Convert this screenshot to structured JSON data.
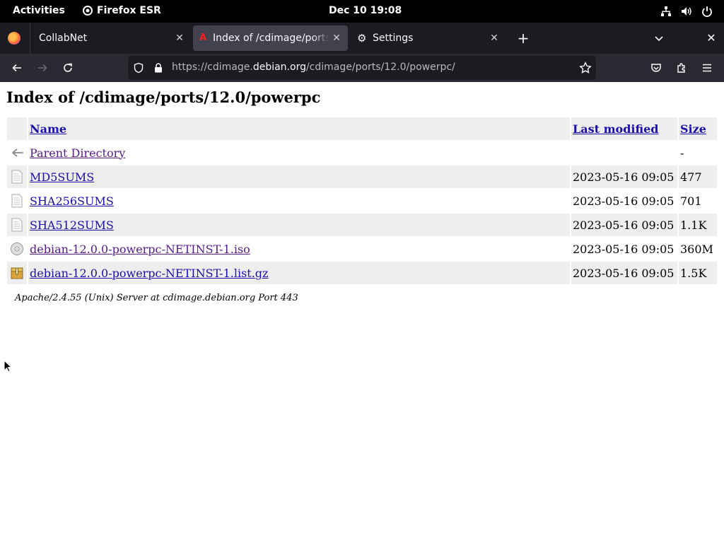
{
  "topbar": {
    "activities": "Activities",
    "app_name": "Firefox ESR",
    "clock": "Dec 10  19:08"
  },
  "tabs": [
    {
      "label": "CollabNet"
    },
    {
      "label": "Index of /cdimage/ports/12.0/powerpc/"
    },
    {
      "label": "Settings"
    }
  ],
  "urlbar": {
    "url_prefix": "https://cdimage.",
    "url_domain": "debian.org",
    "url_suffix": "/cdimage/ports/12.0/powerpc/"
  },
  "page": {
    "title": "Index of /cdimage/ports/12.0/powerpc",
    "columns": {
      "name": "Name",
      "modified": "Last modified",
      "size": "Size"
    },
    "rows": [
      {
        "icon": "back-icon",
        "name": "Parent Directory",
        "modified": "",
        "size": "-"
      },
      {
        "icon": "text-file-icon",
        "name": "MD5SUMS",
        "modified": "2023-05-16 09:05",
        "size": "477"
      },
      {
        "icon": "text-file-icon",
        "name": "SHA256SUMS",
        "modified": "2023-05-16 09:05",
        "size": "701"
      },
      {
        "icon": "text-file-icon",
        "name": "SHA512SUMS",
        "modified": "2023-05-16 09:05",
        "size": "1.1K"
      },
      {
        "icon": "cd-icon",
        "name": "debian-12.0.0-powerpc-NETINST-1.iso",
        "modified": "2023-05-16 09:05",
        "size": "360M"
      },
      {
        "icon": "compressed-icon",
        "name": "debian-12.0.0-powerpc-NETINST-1.list.gz",
        "modified": "2023-05-16 09:05",
        "size": "1.5K"
      }
    ],
    "footer": "Apache/2.4.55 (Unix) Server at cdimage.debian.org Port 443"
  }
}
